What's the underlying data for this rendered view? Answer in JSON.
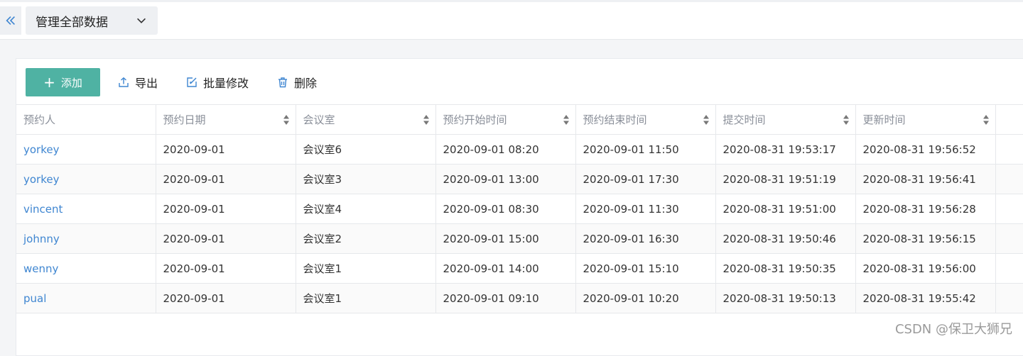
{
  "topbar": {
    "scope_select": {
      "selected": "管理全部数据"
    }
  },
  "toolbar": {
    "add_label": "添加",
    "export_label": "导出",
    "batch_edit_label": "批量修改",
    "delete_label": "删除"
  },
  "table": {
    "columns": [
      "预约人",
      "预约日期",
      "会议室",
      "预约开始时间",
      "预约结束时间",
      "提交时间",
      "更新时间"
    ],
    "rows": [
      [
        "yorkey",
        "2020-09-01",
        "会议室6",
        "2020-09-01 08:20",
        "2020-09-01 11:50",
        "2020-08-31 19:53:17",
        "2020-08-31 19:56:52"
      ],
      [
        "yorkey",
        "2020-09-01",
        "会议室3",
        "2020-09-01 13:00",
        "2020-09-01 17:30",
        "2020-08-31 19:51:19",
        "2020-08-31 19:56:41"
      ],
      [
        "vincent",
        "2020-09-01",
        "会议室4",
        "2020-09-01 08:30",
        "2020-09-01 11:30",
        "2020-08-31 19:51:00",
        "2020-08-31 19:56:28"
      ],
      [
        "johnny",
        "2020-09-01",
        "会议室2",
        "2020-09-01 15:00",
        "2020-09-01 16:30",
        "2020-08-31 19:50:46",
        "2020-08-31 19:56:15"
      ],
      [
        "wenny",
        "2020-09-01",
        "会议室1",
        "2020-09-01 14:00",
        "2020-09-01 15:10",
        "2020-08-31 19:50:35",
        "2020-08-31 19:56:00"
      ],
      [
        "pual",
        "2020-09-01",
        "会议室1",
        "2020-09-01 09:10",
        "2020-09-01 10:20",
        "2020-08-31 19:50:13",
        "2020-08-31 19:55:42"
      ]
    ]
  },
  "watermark": "CSDN @保卫大狮兄",
  "colors": {
    "accent": "#4fb2a3",
    "link": "#3f86d1",
    "header_text": "#8a8f99"
  },
  "icons": {
    "collapse": "double-chevron-left-icon",
    "dropdown": "chevron-down-icon",
    "add": "plus-icon",
    "export": "upload-icon",
    "batch_edit": "edit-icon",
    "delete": "trash-icon",
    "sort": "sort-arrows-icon"
  }
}
